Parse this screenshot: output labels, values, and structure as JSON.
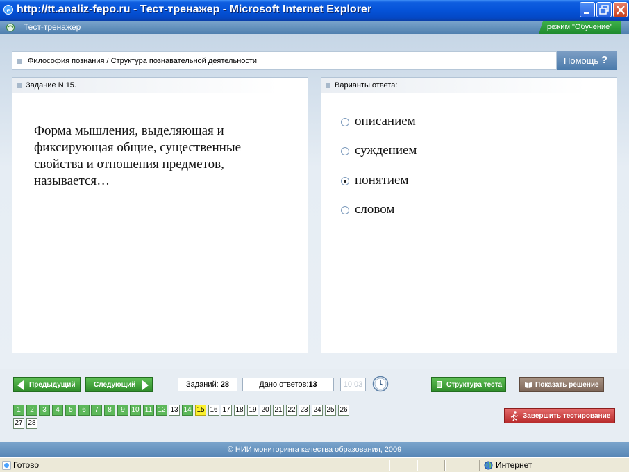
{
  "window": {
    "title": "http://tt.analiz-fepo.ru - Тест-тренажер - Microsoft Internet Explorer"
  },
  "app": {
    "title": "Тест-тренажер",
    "mode": "режим \"Обучение\""
  },
  "breadcrumb": "Философия познания / Структура познавательной деятельности",
  "help": {
    "label": "Помощь",
    "icon": "?"
  },
  "task": {
    "header": "Задание N 15.",
    "question": "Форма мышления, выделяющая и фиксирующая общие, существенные свойства и отношения предметов, называется…"
  },
  "answers": {
    "header": "Варианты ответа:",
    "options": [
      {
        "label": "описанием",
        "selected": false
      },
      {
        "label": "суждением",
        "selected": false
      },
      {
        "label": "понятием",
        "selected": true
      },
      {
        "label": "словом",
        "selected": false
      }
    ]
  },
  "nav": {
    "prev_label": "Предыдущий",
    "next_label": "Следующий",
    "tasks_label": "Заданий:",
    "tasks_value": "28",
    "answers_label": "Дано ответов:",
    "answers_value": "13",
    "timer": "10:03",
    "structure_label": "Структура теста",
    "solution_label": "Показать решение",
    "finish_label": "Завершить тестирование"
  },
  "questions": [
    {
      "n": "1",
      "state": "answered"
    },
    {
      "n": "2",
      "state": "answered"
    },
    {
      "n": "3",
      "state": "answered"
    },
    {
      "n": "4",
      "state": "answered"
    },
    {
      "n": "5",
      "state": "answered"
    },
    {
      "n": "6",
      "state": "answered"
    },
    {
      "n": "7",
      "state": "answered"
    },
    {
      "n": "8",
      "state": "answered"
    },
    {
      "n": "9",
      "state": "answered"
    },
    {
      "n": "10",
      "state": "answered"
    },
    {
      "n": "11",
      "state": "answered"
    },
    {
      "n": "12",
      "state": "answered"
    },
    {
      "n": "13",
      "state": "open"
    },
    {
      "n": "14",
      "state": "answered"
    },
    {
      "n": "15",
      "state": "current"
    },
    {
      "n": "16",
      "state": "open"
    },
    {
      "n": "17",
      "state": "open"
    },
    {
      "n": "18",
      "state": "open"
    },
    {
      "n": "19",
      "state": "open"
    },
    {
      "n": "20",
      "state": "open"
    },
    {
      "n": "21",
      "state": "open"
    },
    {
      "n": "22",
      "state": "open"
    },
    {
      "n": "23",
      "state": "open"
    },
    {
      "n": "24",
      "state": "open"
    },
    {
      "n": "25",
      "state": "open"
    },
    {
      "n": "26",
      "state": "open"
    },
    {
      "n": "27",
      "state": "open"
    },
    {
      "n": "28",
      "state": "open"
    }
  ],
  "footer": "© НИИ мониторинга качества образования, 2009",
  "statusbar": {
    "status": "Готово",
    "zone": "Интернет"
  },
  "colors": {
    "titlebar": "#0553d8",
    "header": "#5f8dbb",
    "answered": "#5db85a",
    "current": "#fbf02d",
    "finish": "#c83434",
    "mode": "#2a9a38"
  }
}
